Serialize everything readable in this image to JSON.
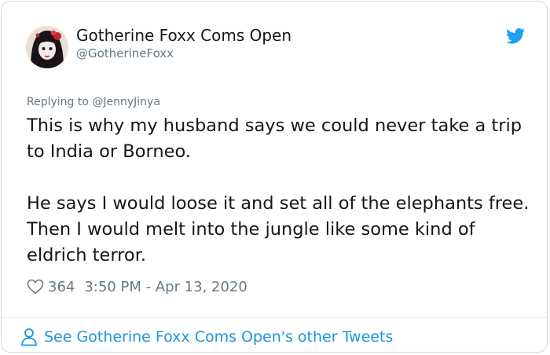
{
  "author": {
    "name": "Gotherine Foxx Coms Open",
    "handle": "@GotherineFoxx"
  },
  "tweet": {
    "replying_to": "Replying to @JennyJinya",
    "paragraphs": [
      "This is why my husband says we could never take a trip to India or Borneo.",
      "He says I would loose it and set all of the elephants free. Then I would melt into the jungle like some kind of eldrich terror."
    ],
    "likes": "364",
    "timestamp": "3:50 PM - Apr 13, 2020"
  },
  "footer": {
    "link_text": "See Gotherine Foxx Coms Open's other Tweets"
  },
  "icons": {
    "brand": "twitter-bird-icon",
    "like": "heart-icon",
    "profile": "person-icon"
  },
  "colors": {
    "brand_blue": "#1da1f2",
    "link_blue": "#1b95e0",
    "text": "#14171a",
    "muted": "#657786"
  }
}
